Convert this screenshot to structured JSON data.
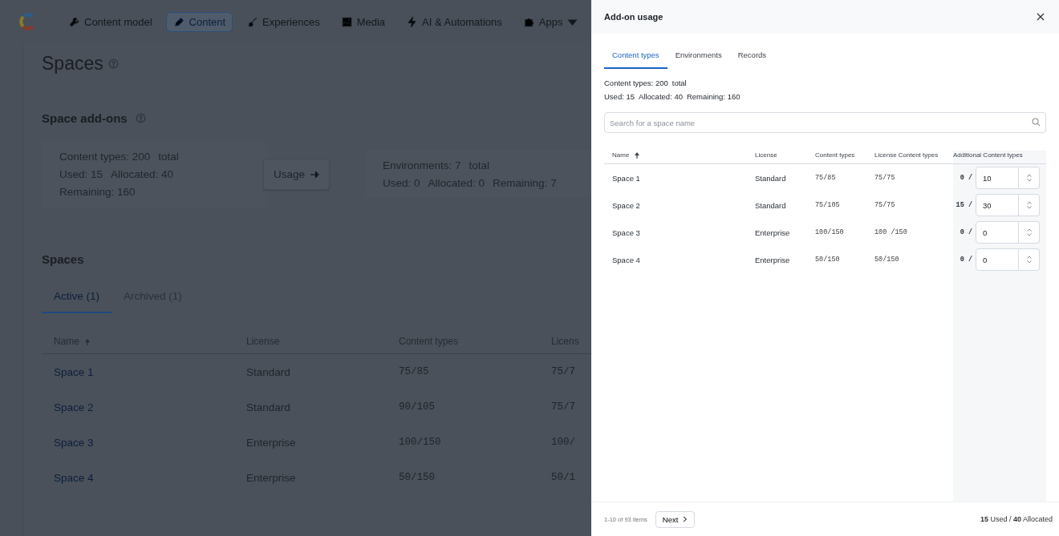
{
  "nav": {
    "items": [
      {
        "label": "Content model",
        "selected": false
      },
      {
        "label": "Content",
        "selected": true
      },
      {
        "label": "Experiences",
        "selected": false
      },
      {
        "label": "Media",
        "selected": false
      },
      {
        "label": "AI & Automations",
        "selected": false
      },
      {
        "label": "Apps",
        "selected": false
      }
    ]
  },
  "page": {
    "title": "Spaces",
    "addons_title": "Space add-ons",
    "addon_cards": [
      {
        "lines": [
          [
            "Content types: 200",
            "total"
          ],
          [
            "Used: 15",
            "Allocated: 40"
          ],
          [
            "Remaining: 160"
          ]
        ]
      },
      {
        "lines": [
          [
            "Environments: 7",
            "total"
          ],
          [
            "Used: 0",
            "Allocated: 0",
            "Remaining: 7"
          ]
        ]
      }
    ],
    "usage_button": "Usage",
    "spaces_title": "Spaces",
    "tabs": [
      {
        "label": "Active (1)",
        "selected": true
      },
      {
        "label": "Archived (1)",
        "selected": false
      }
    ],
    "table": {
      "columns": [
        {
          "label": "Name",
          "sorted": true
        },
        {
          "label": "License",
          "sorted": false
        },
        {
          "label": "Content types",
          "sorted": false
        },
        {
          "label": "Licens",
          "sorted": false
        }
      ],
      "rows": [
        [
          "Space 1",
          "Standard",
          "75/85",
          "75/7"
        ],
        [
          "Space 2",
          "Standard",
          "90/105",
          "75/7"
        ],
        [
          "Space 3",
          "Enterprise",
          "100/150",
          "100/"
        ],
        [
          "Space 4",
          "Enterprise",
          "50/150",
          "50/1"
        ]
      ]
    }
  },
  "drawer": {
    "title": "Add-on usage",
    "tabs": [
      {
        "label": "Content types",
        "selected": true
      },
      {
        "label": "Environments",
        "selected": false
      },
      {
        "label": "Records",
        "selected": false
      }
    ],
    "summary": [
      [
        "Content types: 200",
        "total"
      ],
      [
        "Used: 15",
        "Allocated: 40",
        "Remaining: 160"
      ]
    ],
    "search": {
      "placeholder": "Search for a space name"
    },
    "columns": [
      {
        "label": "Name",
        "sorted": true
      },
      {
        "label": "License",
        "sorted": false
      },
      {
        "label": "Content types",
        "sorted": false
      },
      {
        "label": "License Content types",
        "sorted": false
      },
      {
        "label": "Additional Content types",
        "sorted": false
      }
    ],
    "rows": [
      {
        "name": "Space 1",
        "license": "Standard",
        "content_types": "75/85",
        "license_content_types": "75/75",
        "used": "0 /",
        "value": "10"
      },
      {
        "name": "Space 2",
        "license": "Standard",
        "content_types": "75/105",
        "license_content_types": "75/75",
        "used": "15 /",
        "value": "30"
      },
      {
        "name": "Space 3",
        "license": "Enterprise",
        "content_types": "100/150",
        "license_content_types": "100 /150",
        "used": "0 /",
        "value": "0"
      },
      {
        "name": "Space 4",
        "license": "Enterprise",
        "content_types": "50/150",
        "license_content_types": "50/150",
        "used": "0 /",
        "value": "0"
      }
    ],
    "pagination": "1-10 of 93 items",
    "next_button": "Next",
    "total": "**15** Used / **40** Allocated"
  }
}
